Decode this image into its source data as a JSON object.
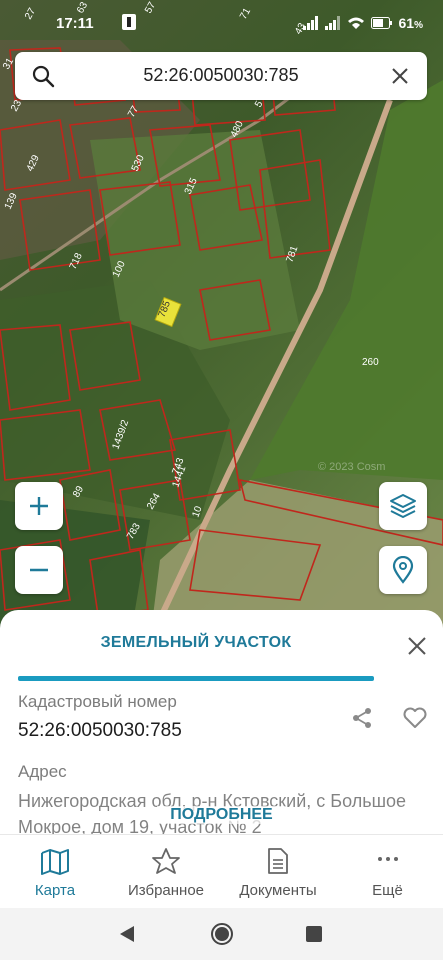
{
  "status_bar": {
    "time": "17:11",
    "battery": "61"
  },
  "search": {
    "query": "52:26:0050030:785"
  },
  "map": {
    "parcel_labels": [
      "27",
      "63",
      "57",
      "71",
      "43",
      "31",
      "530",
      "23",
      "5",
      "429",
      "77",
      "480",
      "139",
      "315",
      "718",
      "100",
      "781",
      "785",
      "260",
      "1439/2",
      "743",
      "1441",
      "264",
      "89",
      "783",
      "10"
    ],
    "highlight_label": "785",
    "watermark": "© 2023 Cosm"
  },
  "sheet": {
    "title": "ЗЕМЕЛЬНЫЙ УЧАСТОК",
    "cadastral_label": "Кадастровый номер",
    "cadastral_value": "52:26:0050030:785",
    "address_label": "Адрес",
    "address_value": "Нижегородская обл, р-н Кстовский, с Большое Мокрое, дом 19, участок № 2",
    "more": "ПОДРОБНЕЕ"
  },
  "nav": {
    "map": "Карта",
    "favorites": "Избранное",
    "documents": "Документы",
    "more": "Ещё"
  },
  "colors": {
    "accent": "#1f7a99",
    "accent_bar": "#1a9bc0",
    "parcel_outline": "#c0271c",
    "highlight": "#e8e23a"
  }
}
